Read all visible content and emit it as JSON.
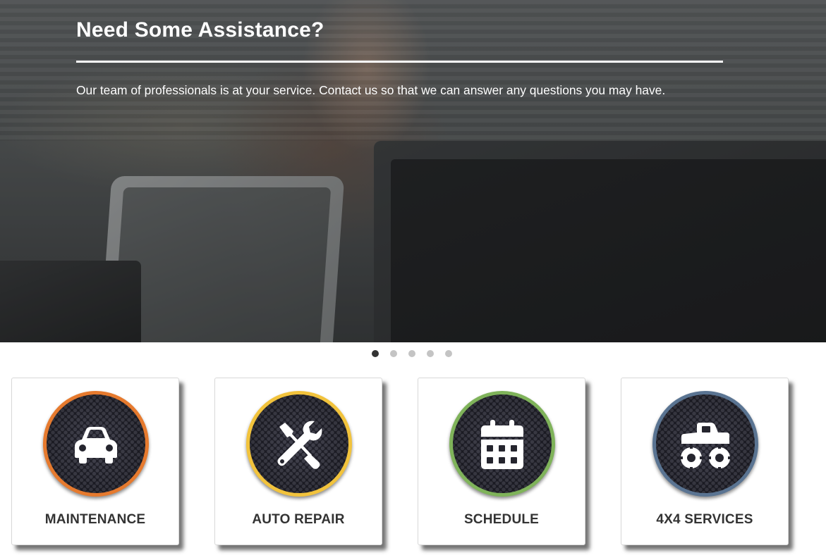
{
  "hero": {
    "title": "Need Some Assistance?",
    "text": "Our team of professionals is at your service. Contact us so that we can answer any questions you may have."
  },
  "slider": {
    "dots": [
      {
        "label": "slide-1",
        "active": true
      },
      {
        "label": "slide-2",
        "active": false
      },
      {
        "label": "slide-3",
        "active": false
      },
      {
        "label": "slide-4",
        "active": false
      },
      {
        "label": "slide-5",
        "active": false
      }
    ]
  },
  "services": [
    {
      "label": "MAINTENANCE",
      "icon": "car-icon",
      "ring_color": "#e67a2e"
    },
    {
      "label": "AUTO REPAIR",
      "icon": "wrench-screwdriver-icon",
      "ring_color": "#f2c33c"
    },
    {
      "label": "SCHEDULE",
      "icon": "calendar-icon",
      "ring_color": "#7fb35a"
    },
    {
      "label": "4X4 SERVICES",
      "icon": "monster-truck-icon",
      "ring_color": "#5a7492"
    }
  ],
  "colors": {
    "text_dark": "#333333",
    "dot_active": "#333333",
    "dot_inactive": "#c4c4c4"
  }
}
